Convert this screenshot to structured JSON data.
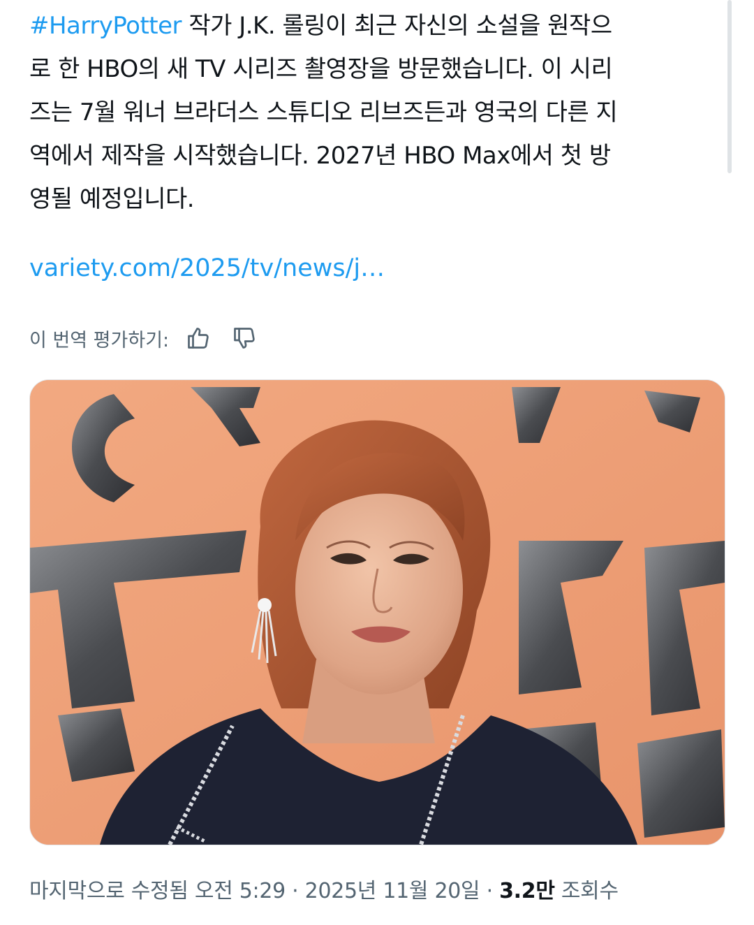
{
  "tweet": {
    "hashtag": "#HarryPotter",
    "line1_rest": " 작가 J.K. 롤링이 최근 자신의 소설을 원작으",
    "line2": "로 한 HBO의 새 TV 시리즈 촬영장을 방문했습니다. 이 시리",
    "line3": "즈는 7월 워너 브라더스 스튜디오 리브즈든과 영국의 다른 지",
    "line4": "역에서 제작을 시작했습니다. 2027년 HBO Max에서 첫 방",
    "line5": "영될 예정입니다.",
    "link_text": "variety.com/2025/tv/news/j…"
  },
  "translation": {
    "rate_label": "이 번역 평가하기:",
    "thumbs_up_icon": "thumbs-up-icon",
    "thumbs_down_icon": "thumbs-down-icon"
  },
  "media": {
    "photo_icon": "portrait-photo"
  },
  "meta": {
    "edited_label": "마지막으로 수정됨",
    "time": "오전 5:29",
    "separator": "·",
    "date": "2025년 11월 20일",
    "views_count": "3.2만",
    "views_label": "조회수"
  },
  "colors": {
    "link_blue": "#1d9bf0",
    "text_primary": "#0f1419",
    "text_secondary": "#536471",
    "photo_background": "#efa27c"
  }
}
